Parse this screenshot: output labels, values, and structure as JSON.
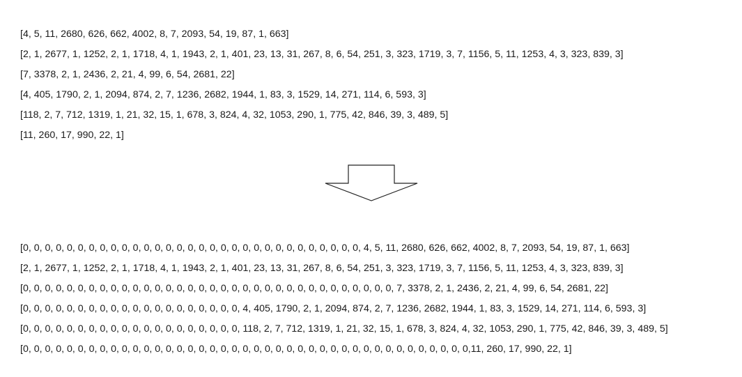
{
  "before": {
    "lines": [
      "[4, 5, 11, 2680, 626, 662, 4002, 8, 7, 2093, 54, 19, 87, 1, 663]",
      "[2, 1, 2677, 1, 1252, 2, 1, 1718, 4, 1, 1943, 2, 1, 401, 23, 13, 31, 267, 8, 6, 54, 251, 3, 323, 1719, 3, 7, 1156, 5, 11, 1253, 4, 3, 323, 839, 3]",
      "[7, 3378, 2, 1, 2436, 2, 21, 4, 99, 6, 54, 2681, 22]",
      "[4, 405, 1790, 2, 1, 2094, 874, 2, 7, 1236, 2682, 1944, 1, 83, 3, 1529, 14, 271, 114, 6, 593, 3]",
      "[118, 2, 7, 712, 1319, 1, 21, 32, 15, 1, 678, 3, 824, 4, 32, 1053, 290, 1, 775, 42, 846, 39, 3, 489, 5]",
      "[11, 260, 17, 990, 22, 1]"
    ]
  },
  "after": {
    "lines": [
      "[0, 0, 0, 0, 0, 0, 0, 0, 0, 0, 0, 0, 0, 0, 0, 0, 0, 0, 0, 0, 0, 0, 0, 0, 0, 0, 0, 0, 0, 0, 0, 4, 5, 11, 2680, 626, 662, 4002, 8, 7, 2093, 54, 19, 87, 1, 663]",
      "[2, 1, 2677, 1, 1252, 2, 1, 1718, 4, 1, 1943, 2, 1, 401, 23, 13, 31, 267, 8, 6, 54, 251, 3, 323, 1719, 3, 7, 1156, 5, 11, 1253, 4, 3, 323, 839, 3]",
      "[0, 0, 0, 0, 0, 0, 0, 0, 0, 0, 0, 0, 0, 0, 0, 0, 0, 0, 0, 0, 0, 0, 0, 0, 0, 0, 0, 0, 0, 0, 0, 0, 0, 0, 7, 3378, 2, 1, 2436, 2, 21, 4, 99, 6, 54, 2681, 22]",
      "[0, 0, 0, 0, 0, 0, 0, 0, 0, 0, 0, 0, 0, 0, 0, 0, 0, 0, 0, 0, 4, 405, 1790, 2, 1, 2094, 874, 2, 7, 1236, 2682, 1944, 1, 83, 3, 1529, 14, 271, 114, 6, 593, 3]",
      "[0, 0, 0, 0, 0, 0, 0, 0, 0, 0, 0, 0, 0, 0, 0, 0, 0, 0, 0, 0, 118, 2, 7, 712, 1319, 1, 21, 32, 15, 1, 678, 3, 824, 4, 32, 1053, 290, 1, 775, 42, 846, 39, 3, 489, 5]",
      "[0, 0, 0, 0, 0, 0, 0, 0, 0, 0, 0, 0, 0, 0, 0, 0, 0, 0, 0, 0, 0, 0, 0, 0, 0, 0, 0, 0, 0, 0, 0, 0, 0, 0, 0, 0, 0, 0, 0, 0, 0,11, 260, 17, 990, 22, 1]"
    ]
  },
  "arrow": {
    "icon": "down-arrow-icon",
    "stroke_color": "#222222",
    "fill_color": "#ffffff"
  }
}
